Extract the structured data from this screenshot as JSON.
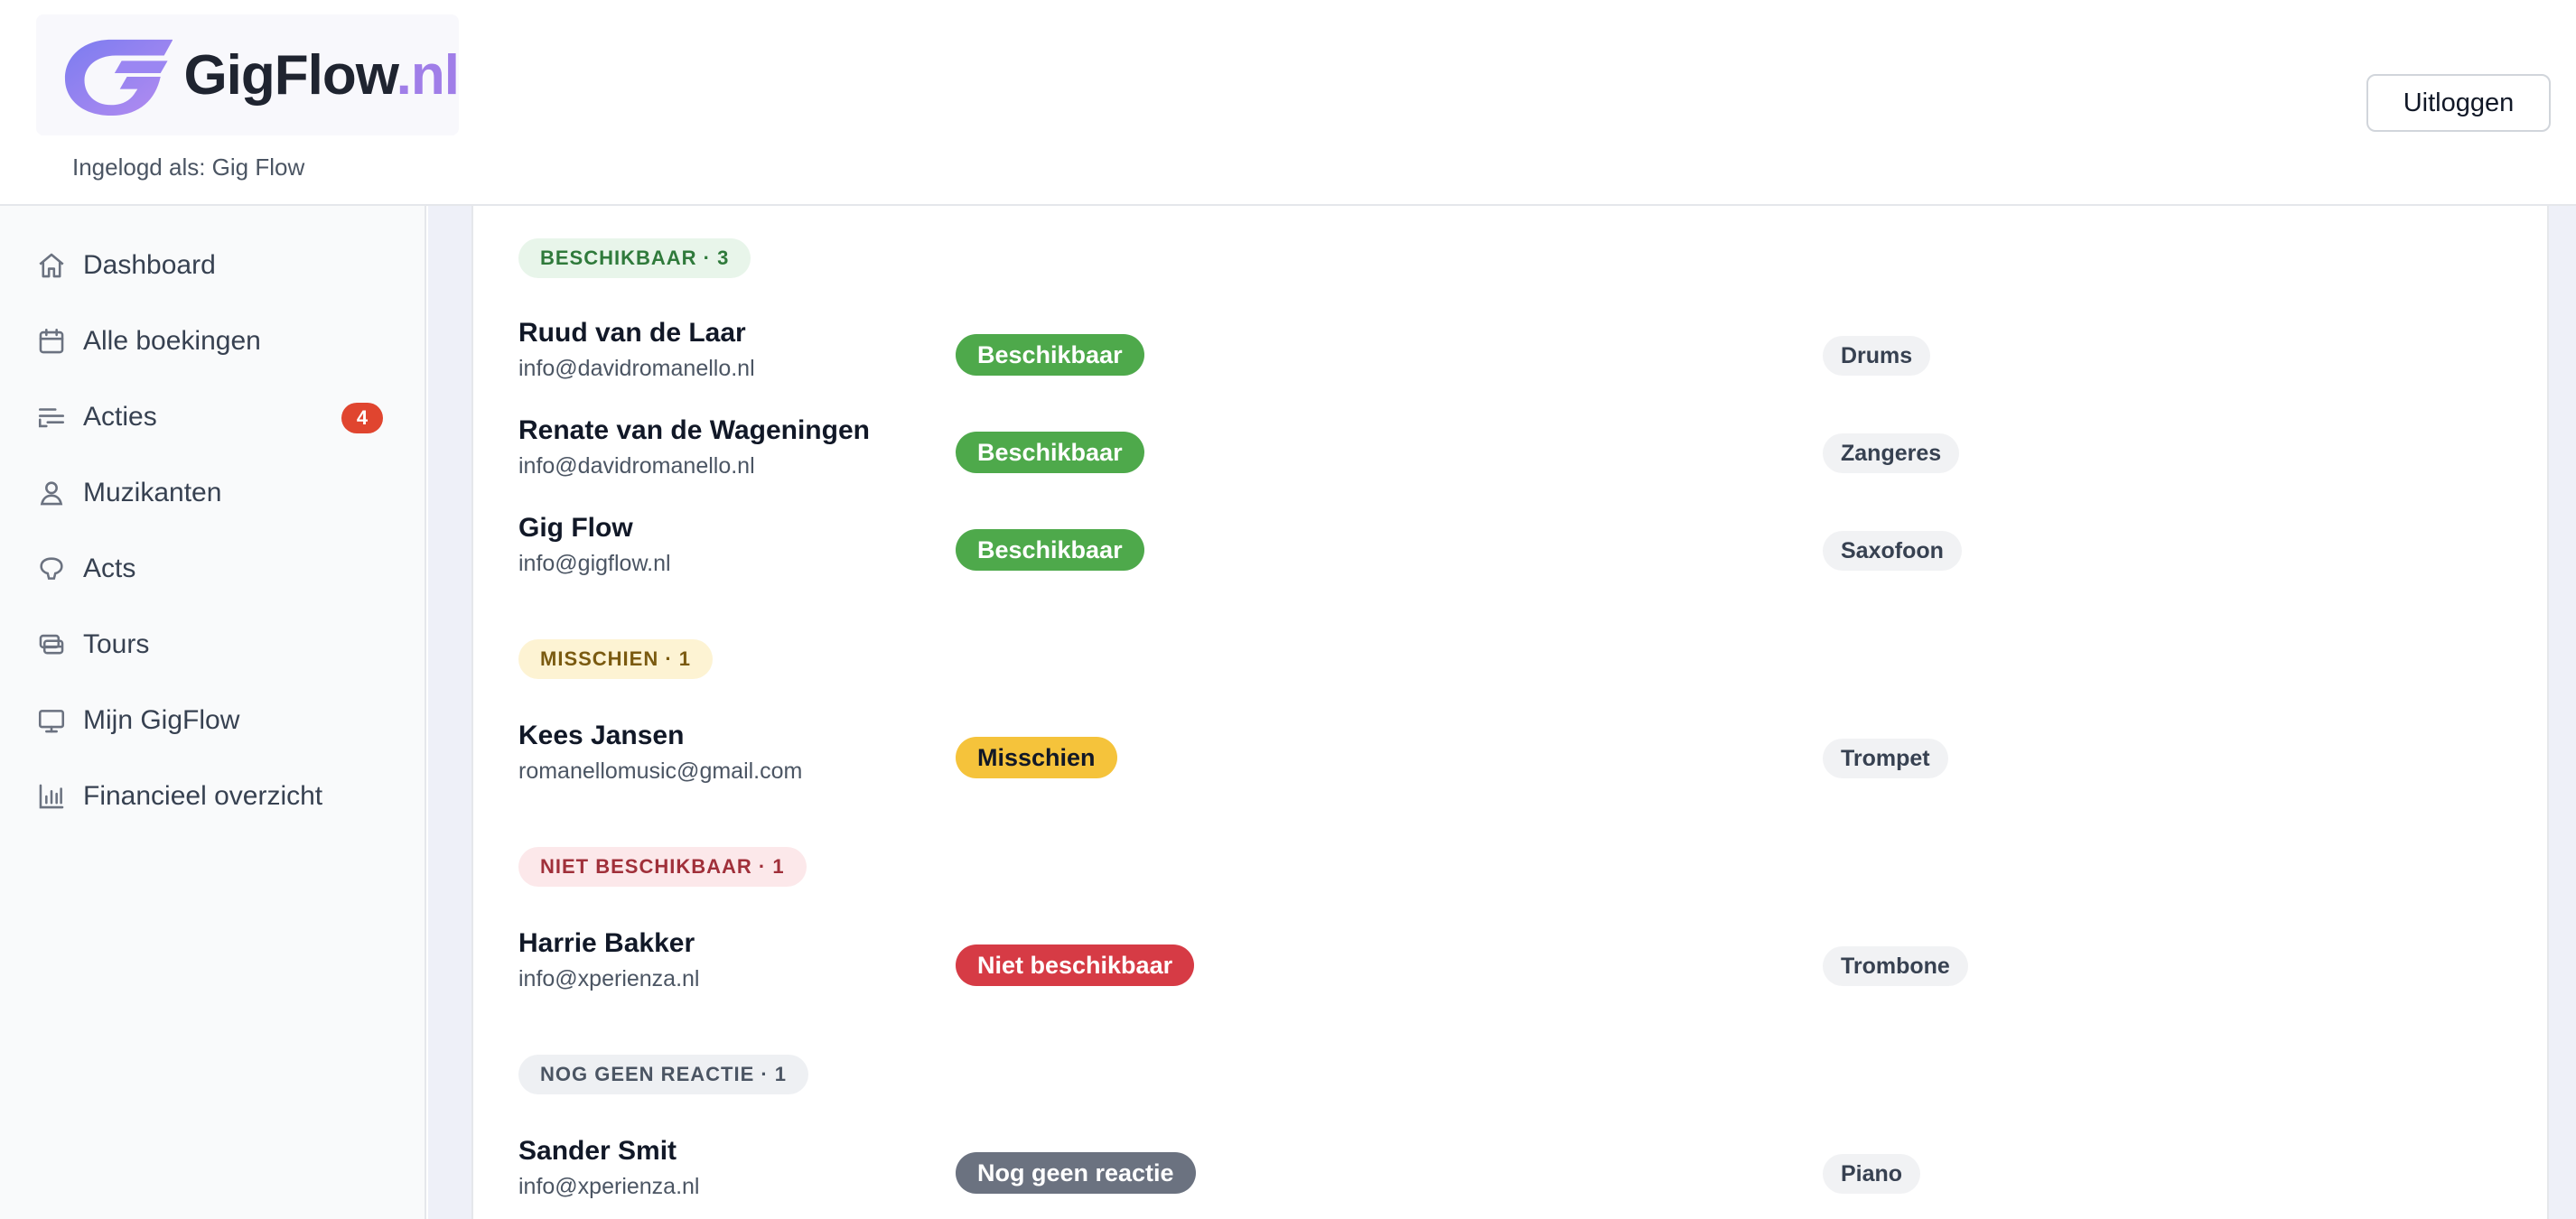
{
  "header": {
    "logo_main": "GigFlow",
    "logo_tld": ".nl",
    "logged_in_text": "Ingelogd als: Gig Flow",
    "logout_label": "Uitloggen"
  },
  "sidebar": {
    "items": [
      {
        "label": "Dashboard",
        "icon": "home-icon"
      },
      {
        "label": "Alle boekingen",
        "icon": "calendar-icon"
      },
      {
        "label": "Acties",
        "icon": "actions-icon",
        "badge": "4"
      },
      {
        "label": "Muzikanten",
        "icon": "user-icon"
      },
      {
        "label": "Acts",
        "icon": "acts-icon"
      },
      {
        "label": "Tours",
        "icon": "tours-icon"
      },
      {
        "label": "Mijn GigFlow",
        "icon": "monitor-icon"
      },
      {
        "label": "Financieel overzicht",
        "icon": "chart-icon"
      }
    ]
  },
  "groups": [
    {
      "label": "BESCHIKBAAR · 3",
      "members": [
        {
          "name": "Ruud van de Laar",
          "email": "info@davidromanello.nl",
          "status": "Beschikbaar",
          "instrument": "Drums"
        },
        {
          "name": "Renate van de Wageningen",
          "email": "info@davidromanello.nl",
          "status": "Beschikbaar",
          "instrument": "Zangeres"
        },
        {
          "name": "Gig Flow",
          "email": "info@gigflow.nl",
          "status": "Beschikbaar",
          "instrument": "Saxofoon"
        }
      ]
    },
    {
      "label": "MISSCHIEN · 1",
      "members": [
        {
          "name": "Kees Jansen",
          "email": "romanellomusic@gmail.com",
          "status": "Misschien",
          "instrument": "Trompet"
        }
      ]
    },
    {
      "label": "NIET BESCHIKBAAR · 1",
      "members": [
        {
          "name": "Harrie Bakker",
          "email": "info@xperienza.nl",
          "status": "Niet beschikbaar",
          "instrument": "Trombone"
        }
      ]
    },
    {
      "label": "NOG GEEN REACTIE · 1",
      "members": [
        {
          "name": "Sander Smit",
          "email": "info@xperienza.nl",
          "status": "Nog geen reactie",
          "instrument": "Piano"
        }
      ]
    }
  ],
  "colors": {
    "available": "#4ea94b",
    "maybe": "#f5c33b",
    "unavailable": "#d63b45",
    "no_response": "#6b7280",
    "badge": "#e0452f",
    "brand_tld": "#a07ee8"
  }
}
